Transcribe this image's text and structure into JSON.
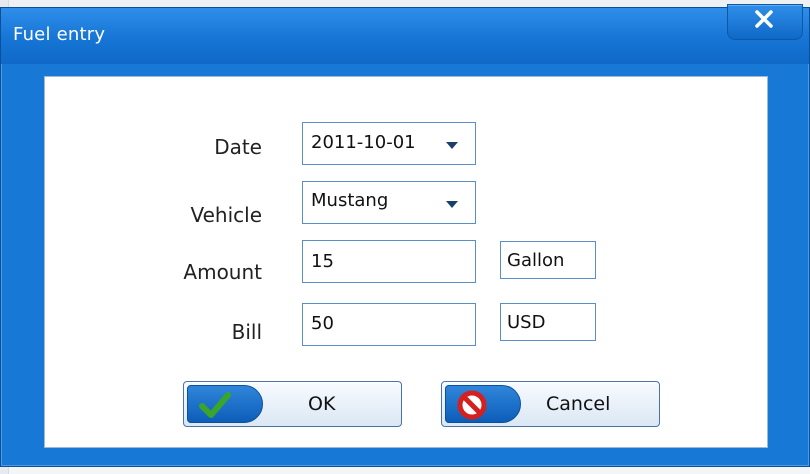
{
  "window": {
    "title": "Fuel entry"
  },
  "form": {
    "date": {
      "label": "Date",
      "value": "2011-10-01"
    },
    "vehicle": {
      "label": "Vehicle",
      "value": "Mustang"
    },
    "amount": {
      "label": "Amount",
      "value": "15",
      "unit": "Gallon"
    },
    "bill": {
      "label": "Bill",
      "value": "50",
      "unit": "USD"
    }
  },
  "buttons": {
    "ok": "OK",
    "cancel": "Cancel"
  },
  "icons": {
    "close": "close-icon",
    "ok": "checkmark-icon",
    "cancel": "prohibited-icon",
    "dropdown": "chevron-down-icon"
  },
  "colors": {
    "window": "#1878d6",
    "accent": "#0d5db8",
    "ok_icon": "#3aa52a",
    "cancel_icon": "#d61f1f"
  }
}
